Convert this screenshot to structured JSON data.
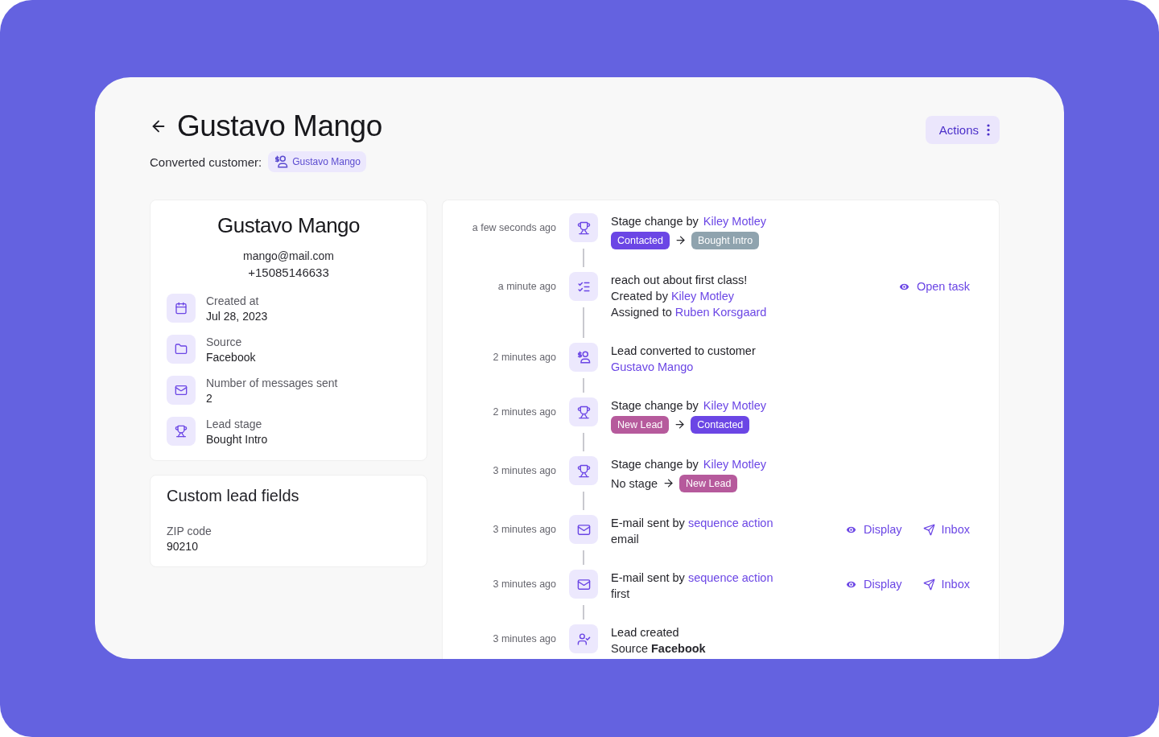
{
  "header": {
    "title": "Gustavo Mango",
    "converted_label": "Converted customer:",
    "converted_customer": "Gustavo Mango",
    "actions_button": "Actions"
  },
  "profile": {
    "name": "Gustavo Mango",
    "email": "mango@mail.com",
    "phone": "+15085146633",
    "fields": [
      {
        "kind": "date",
        "label": "Created at",
        "value": "Jul 28, 2023"
      },
      {
        "kind": "source",
        "label": "Source",
        "value": "Facebook"
      },
      {
        "kind": "messages",
        "label": "Number of messages sent",
        "value": "2"
      },
      {
        "kind": "stage",
        "label": "Lead stage",
        "value": "Bought Intro"
      }
    ]
  },
  "custom_fields": {
    "title": "Custom lead fields",
    "fields": [
      {
        "label": "ZIP code",
        "value": "90210"
      }
    ]
  },
  "timeline": [
    {
      "kind": "stage_change",
      "time": "a few seconds ago",
      "title": "Stage change by",
      "actor": "Kiley Motley",
      "from": {
        "label": "Contacted",
        "color": "#6b46e5"
      },
      "to": {
        "label": "Bought Intro",
        "color": "#8fa3ae"
      }
    },
    {
      "kind": "task",
      "time": "a minute ago",
      "title": "reach out about first class!",
      "created_label": "Created by",
      "creator": "Kiley Motley",
      "assigned_label": "Assigned to",
      "assignee": "Ruben Korsgaard",
      "action": "Open task"
    },
    {
      "kind": "converted",
      "time": "2 minutes ago",
      "title": "Lead converted to customer",
      "link": "Gustavo Mango"
    },
    {
      "kind": "stage_change",
      "time": "2 minutes ago",
      "title": "Stage change by",
      "actor": "Kiley Motley",
      "from": {
        "label": "New Lead",
        "color": "#b65a9c"
      },
      "to": {
        "label": "Contacted",
        "color": "#6b46e5"
      }
    },
    {
      "kind": "stage_change",
      "time": "3 minutes ago",
      "title": "Stage change by",
      "actor": "Kiley Motley",
      "from_text": "No stage",
      "to": {
        "label": "New Lead",
        "color": "#b65a9c"
      }
    },
    {
      "kind": "email",
      "time": "3 minutes ago",
      "title": "E-mail sent by",
      "link": "sequence action",
      "subject": "email",
      "actions": [
        "Display",
        "Inbox"
      ]
    },
    {
      "kind": "email",
      "time": "3 minutes ago",
      "title": "E-mail sent by",
      "link": "sequence action",
      "subject": "first",
      "actions": [
        "Display",
        "Inbox"
      ]
    },
    {
      "kind": "created",
      "time": "3 minutes ago",
      "title": "Lead created",
      "detail": "Source **Facebook**"
    }
  ]
}
